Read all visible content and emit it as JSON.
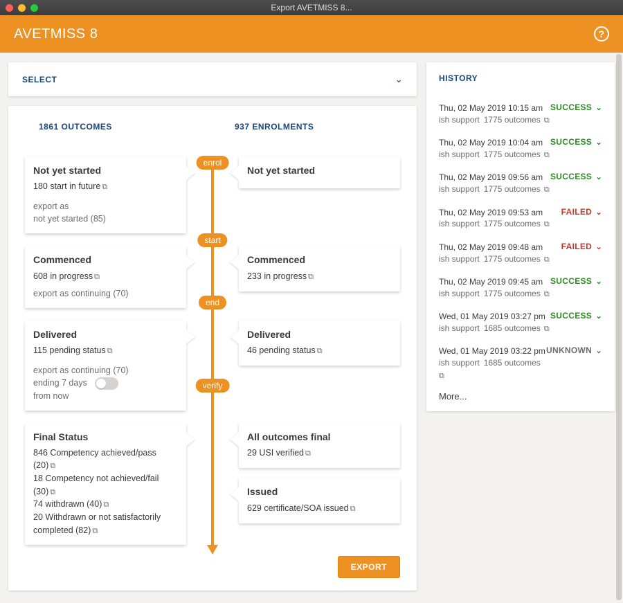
{
  "window_title": "Export AVETMISS 8...",
  "header_title": "AVETMISS 8",
  "select_label": "SELECT",
  "history_label": "HISTORY",
  "outcomes_header": "1861 OUTCOMES",
  "enrolments_header": "937 ENROLMENTS",
  "stages": {
    "enrol": "enrol",
    "start": "start",
    "end": "end",
    "verify": "verify"
  },
  "left": {
    "not_started": {
      "title": "Not yet started",
      "line1": "180 start in future",
      "line2": "export as",
      "line3": "not yet started (85)"
    },
    "commenced": {
      "title": "Commenced",
      "line1": "608 in progress",
      "line2": "export as continuing (70)"
    },
    "delivered": {
      "title": "Delivered",
      "line1": "115 pending status",
      "line2": "export as continuing (70)",
      "line3": "ending 7 days",
      "line4": "from now"
    },
    "final": {
      "title": "Final Status",
      "l1": "846 Competency achieved/pass (20)",
      "l2": "18 Competency not achieved/fail (30)",
      "l3": "74 withdrawn (40)",
      "l4": "20 Withdrawn or not satisfactorily completed (82)"
    }
  },
  "right": {
    "not_started": {
      "title": "Not yet started"
    },
    "commenced": {
      "title": "Commenced",
      "line1": "233 in progress"
    },
    "delivered": {
      "title": "Delivered",
      "line1": "46 pending status"
    },
    "all_final": {
      "title": "All outcomes final",
      "line1": "29 USI verified"
    },
    "issued": {
      "title": "Issued",
      "line1": "629 certificate/SOA issued"
    }
  },
  "export_button": "EXPORT",
  "more_label": "More...",
  "history": [
    {
      "ts": "Thu, 02 May 2019 10:15 am",
      "user": "ish support",
      "outcomes": "1775 outcomes",
      "status": "SUCCESS"
    },
    {
      "ts": "Thu, 02 May 2019 10:04 am",
      "user": "ish support",
      "outcomes": "1775 outcomes",
      "status": "SUCCESS"
    },
    {
      "ts": "Thu, 02 May 2019 09:56 am",
      "user": "ish support",
      "outcomes": "1775 outcomes",
      "status": "SUCCESS"
    },
    {
      "ts": "Thu, 02 May 2019 09:53 am",
      "user": "ish support",
      "outcomes": "1775 outcomes",
      "status": "FAILED"
    },
    {
      "ts": "Thu, 02 May 2019 09:48 am",
      "user": "ish support",
      "outcomes": "1775 outcomes",
      "status": "FAILED"
    },
    {
      "ts": "Thu, 02 May 2019 09:45 am",
      "user": "ish support",
      "outcomes": "1775 outcomes",
      "status": "SUCCESS"
    },
    {
      "ts": "Wed, 01 May 2019 03:27 pm",
      "user": "ish support",
      "outcomes": "1685 outcomes",
      "status": "SUCCESS"
    },
    {
      "ts": "Wed, 01 May 2019 03:22 pm",
      "user": "ish support",
      "outcomes": "1685 outcomes",
      "status": "UNKNOWN"
    }
  ]
}
